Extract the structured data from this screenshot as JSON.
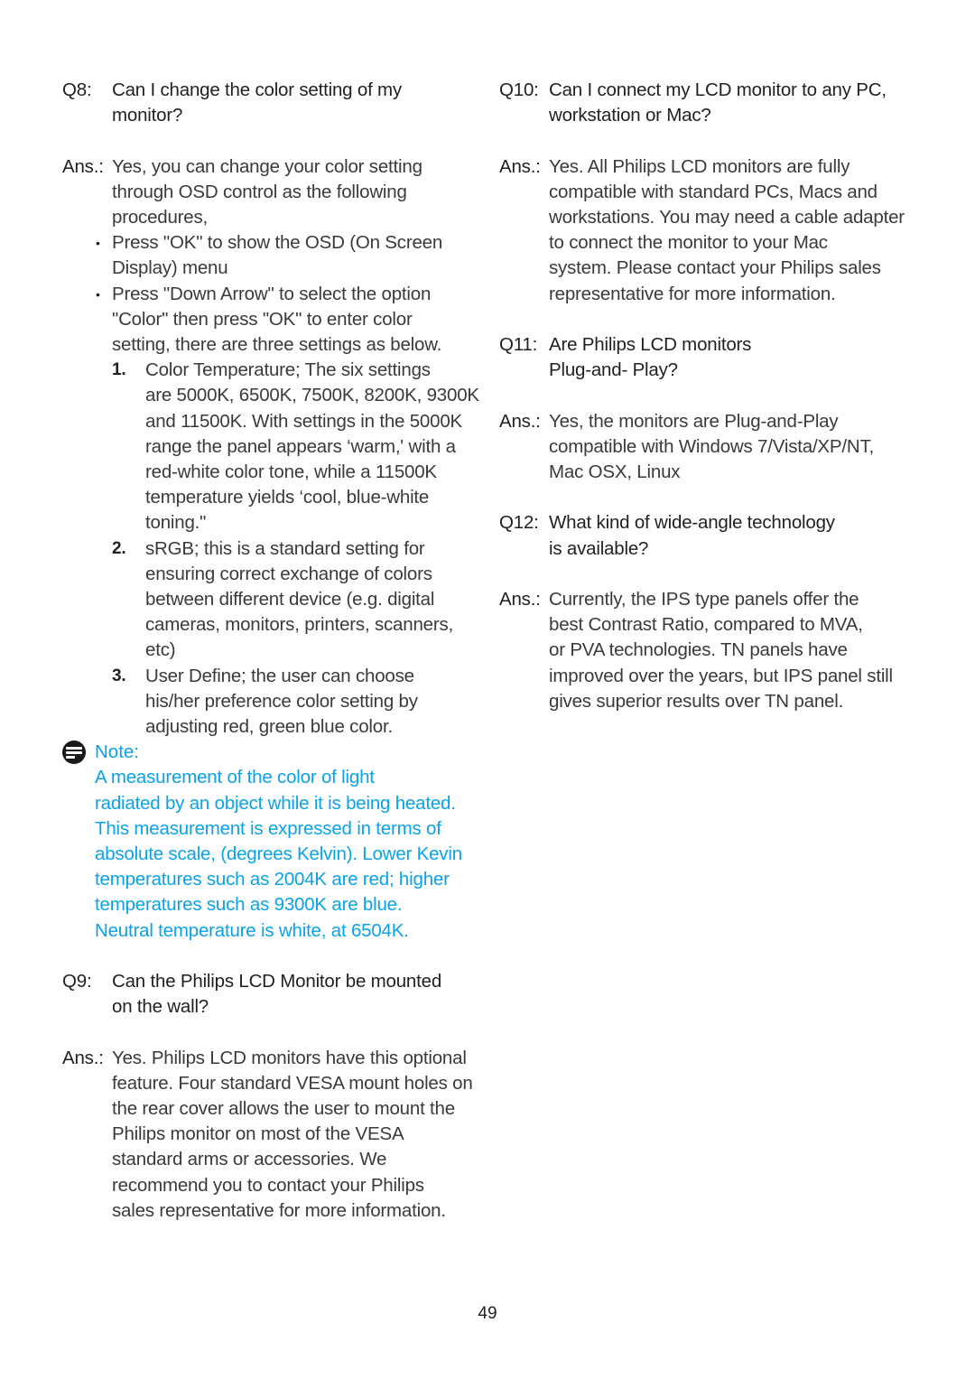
{
  "page_number": "49",
  "note_color": "#0aa2e8",
  "left": {
    "q8": {
      "label": "Q8:",
      "question_lines": [
        "Can I change the color setting of my",
        "monitor?"
      ],
      "ans_label": "Ans.:",
      "answer_lines": [
        "Yes, you can change your color setting",
        "through OSD control as the following",
        "procedures,"
      ],
      "bullets": [
        {
          "symbol": "•",
          "lines": [
            "Press \"OK\" to show the OSD (On Screen",
            "Display) menu"
          ]
        },
        {
          "symbol": "•",
          "lines": [
            "Press \"Down Arrow\" to select the option",
            "\"Color\" then press \"OK\" to enter color",
            "setting, there are three settings as below."
          ]
        }
      ],
      "numbered": [
        {
          "num": "1.",
          "lines": [
            "Color Temperature; The six settings",
            "are 5000K, 6500K, 7500K, 8200K, 9300K",
            "and 11500K. With settings in the 5000K",
            "range the panel appears ‘warm,' with a",
            "red-white color tone, while a 11500K",
            "temperature yields ‘cool, blue-white",
            "toning.\""
          ]
        },
        {
          "num": "2.",
          "lines": [
            "sRGB; this is a standard setting for",
            "ensuring correct exchange of colors",
            "between different device (e.g. digital",
            "cameras, monitors, printers, scanners,",
            "etc)"
          ]
        },
        {
          "num": "3.",
          "lines": [
            "User Define; the user can choose",
            "his/her preference color setting by",
            "adjusting red, green blue color."
          ]
        }
      ]
    },
    "note": {
      "label": "Note:",
      "lines": [
        "A measurement of the color of light",
        "radiated by an object while it is being heated.",
        "This measurement is expressed in terms of",
        "absolute scale, (degrees Kelvin). Lower Kevin",
        "temperatures such as 2004K are red; higher",
        "temperatures such as 9300K are blue.",
        "Neutral temperature is white, at 6504K."
      ]
    },
    "q9": {
      "label": "Q9:",
      "question_lines": [
        "Can the Philips LCD Monitor be  mounted",
        "on the wall?"
      ],
      "ans_label": "Ans.:",
      "answer_lines": [
        "Yes. Philips LCD monitors have this optional",
        "feature. Four standard VESA mount holes on",
        "the rear cover allows the user to mount the",
        "Philips monitor on most of the VESA",
        "standard arms or accessories. We",
        "recommend you to contact your Philips",
        "sales representative for more information."
      ]
    }
  },
  "right": {
    "q10": {
      "label": "Q10:",
      "question_lines": [
        "Can I connect my LCD monitor to any PC,",
        "workstation or Mac?"
      ],
      "ans_label": "Ans.:",
      "answer_lines": [
        "Yes. All Philips LCD monitors are fully",
        "compatible with standard PCs, Macs and",
        "workstations. You may need a cable adapter",
        "to connect the monitor to your Mac",
        "system. Please contact your Philips sales",
        "representative for more information."
      ]
    },
    "q11": {
      "label": "Q11:",
      "question_lines": [
        "Are Philips LCD monitors",
        "Plug-and- Play?"
      ],
      "ans_label": "Ans.:",
      "answer_lines": [
        "Yes, the monitors are Plug-and-Play",
        "compatible with Windows 7/Vista/XP/NT,",
        "Mac OSX, Linux"
      ]
    },
    "q12": {
      "label": "Q12:",
      "question_lines": [
        "What kind of wide-angle technology",
        "is available?"
      ],
      "ans_label": "Ans.:",
      "answer_lines": [
        "Currently, the IPS type panels offer the",
        "best Contrast Ratio, compared to MVA,",
        "or PVA technologies.  TN panels have",
        "improved over the years, but IPS panel still",
        "gives superior results over TN panel."
      ]
    }
  }
}
